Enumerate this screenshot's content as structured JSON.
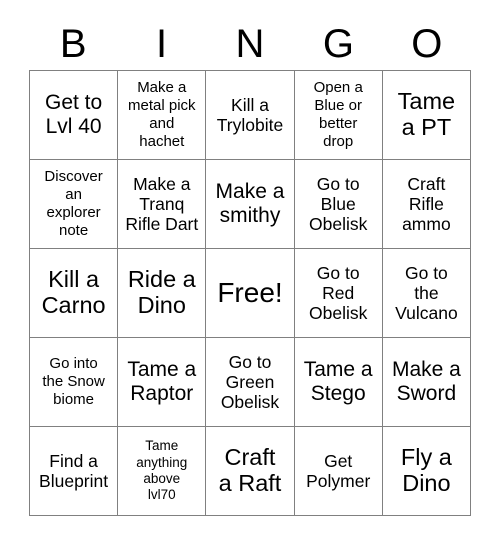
{
  "card": {
    "title": "BINGO",
    "header_letters": [
      "B",
      "I",
      "N",
      "G",
      "O"
    ],
    "grid_size": 5,
    "border_color": "#808080",
    "text_color": "#000000",
    "background_color": "#ffffff"
  },
  "cells": [
    {
      "text": "Get to\nLvl 40",
      "size": "fs-lg",
      "free": false
    },
    {
      "text": "Make a\nmetal pick\nand\nhachet",
      "size": "fs-sm",
      "free": false
    },
    {
      "text": "Kill a\nTrylobite",
      "size": "fs-md",
      "free": false
    },
    {
      "text": "Open a\nBlue or\nbetter\ndrop",
      "size": "fs-sm",
      "free": false
    },
    {
      "text": "Tame\na PT",
      "size": "fs-xl",
      "free": false
    },
    {
      "text": "Discover\nan\nexplorer\nnote",
      "size": "fs-sm",
      "free": false
    },
    {
      "text": "Make a\nTranq\nRifle Dart",
      "size": "fs-md",
      "free": false
    },
    {
      "text": "Make a\nsmithy",
      "size": "fs-lg",
      "free": false
    },
    {
      "text": "Go to\nBlue\nObelisk",
      "size": "fs-md",
      "free": false
    },
    {
      "text": "Craft\nRifle\nammo",
      "size": "fs-md",
      "free": false
    },
    {
      "text": "Kill a\nCarno",
      "size": "fs-xl",
      "free": false
    },
    {
      "text": "Ride a\nDino",
      "size": "fs-xl",
      "free": false
    },
    {
      "text": "Free!",
      "size": "fs-xxl",
      "free": true
    },
    {
      "text": "Go to\nRed\nObelisk",
      "size": "fs-md",
      "free": false
    },
    {
      "text": "Go to\nthe\nVulcano",
      "size": "fs-md",
      "free": false
    },
    {
      "text": "Go into\nthe Snow\nbiome",
      "size": "fs-sm",
      "free": false
    },
    {
      "text": "Tame a\nRaptor",
      "size": "fs-lg",
      "free": false
    },
    {
      "text": "Go to\nGreen\nObelisk",
      "size": "fs-md",
      "free": false
    },
    {
      "text": "Tame a\nStego",
      "size": "fs-lg",
      "free": false
    },
    {
      "text": "Make a\nSword",
      "size": "fs-lg",
      "free": false
    },
    {
      "text": "Find a\nBlueprint",
      "size": "fs-md",
      "free": false
    },
    {
      "text": "Tame\nanything\nabove\nlvl70",
      "size": "fs-xs",
      "free": false
    },
    {
      "text": "Craft\na Raft",
      "size": "fs-xl",
      "free": false
    },
    {
      "text": "Get\nPolymer",
      "size": "fs-md",
      "free": false
    },
    {
      "text": "Fly a\nDino",
      "size": "fs-xl",
      "free": false
    }
  ]
}
